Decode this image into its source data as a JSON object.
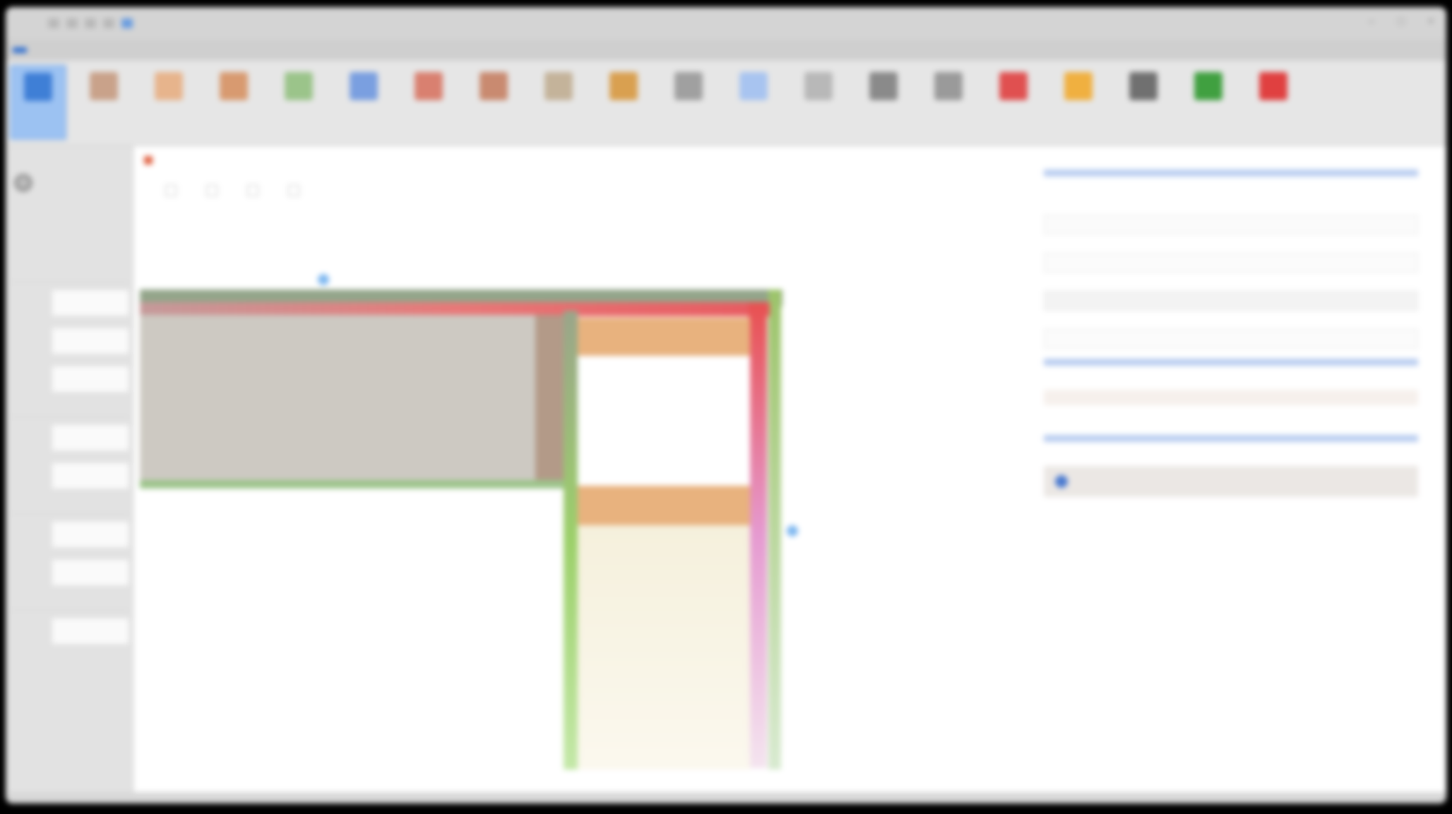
{
  "window": {
    "title": "",
    "controls": [
      "–",
      "□",
      "×"
    ]
  },
  "ribbon": {
    "tabs": [
      "",
      "",
      "",
      "",
      "",
      "",
      "",
      "",
      "",
      "",
      "",
      "",
      "",
      "",
      "",
      "",
      "",
      "",
      "",
      ""
    ],
    "tools": [
      {
        "label": "",
        "color": "#3f7fd6",
        "icon": "select-icon"
      },
      {
        "label": "",
        "color": "#c9a28a",
        "icon": "shape-icon"
      },
      {
        "label": "",
        "color": "#e7b48c",
        "icon": "paint-icon"
      },
      {
        "label": "",
        "color": "#d89a70",
        "icon": "brush-icon"
      },
      {
        "label": "",
        "color": "#9bc48a",
        "icon": "line-icon"
      },
      {
        "label": "",
        "color": "#7a9fe0",
        "icon": "cursor-icon"
      },
      {
        "label": "",
        "color": "#d98070",
        "icon": "pointer-icon"
      },
      {
        "label": "",
        "color": "#c98a70",
        "icon": "layer-icon"
      },
      {
        "label": "",
        "color": "#c4b39a",
        "icon": "align-icon"
      },
      {
        "label": "",
        "color": "#d9a050",
        "icon": "group-icon"
      },
      {
        "label": "",
        "color": "#a0a0a0",
        "icon": "arrange-icon"
      },
      {
        "label": "",
        "color": "#a8c4f0",
        "icon": "frame-icon"
      },
      {
        "label": "",
        "color": "#b8b8b8",
        "icon": "grid-icon"
      },
      {
        "label": "",
        "color": "#8a8a8a",
        "icon": "link-icon"
      },
      {
        "label": "",
        "color": "#9a9a9a",
        "icon": "lock-icon"
      },
      {
        "label": "",
        "color": "#e05050",
        "icon": "color-icon"
      },
      {
        "label": "",
        "color": "#f0b040",
        "icon": "star-icon"
      },
      {
        "label": "",
        "color": "#707070",
        "icon": "image-icon"
      },
      {
        "label": "",
        "color": "#40a040",
        "icon": "export-icon"
      },
      {
        "label": "",
        "color": "#e04040",
        "icon": "delete-icon"
      }
    ]
  },
  "sidebar": {
    "header": "",
    "settings_label": "",
    "sections": [
      "",
      "",
      "",
      ""
    ]
  },
  "document": {
    "tab_title": ""
  },
  "canvas_toolbar": [
    "",
    "",
    "",
    ""
  ],
  "properties": {
    "heading": "",
    "fields": [
      {
        "label": "",
        "value": ""
      },
      {
        "label": "",
        "value": ""
      },
      {
        "label": "",
        "value": ""
      },
      {
        "label": "",
        "value": ""
      }
    ],
    "section2_heading": "",
    "row_values": [
      "",
      ""
    ],
    "row_sub": [
      "",
      ""
    ],
    "section3_heading": "",
    "check_label": "",
    "sub_label": ""
  }
}
